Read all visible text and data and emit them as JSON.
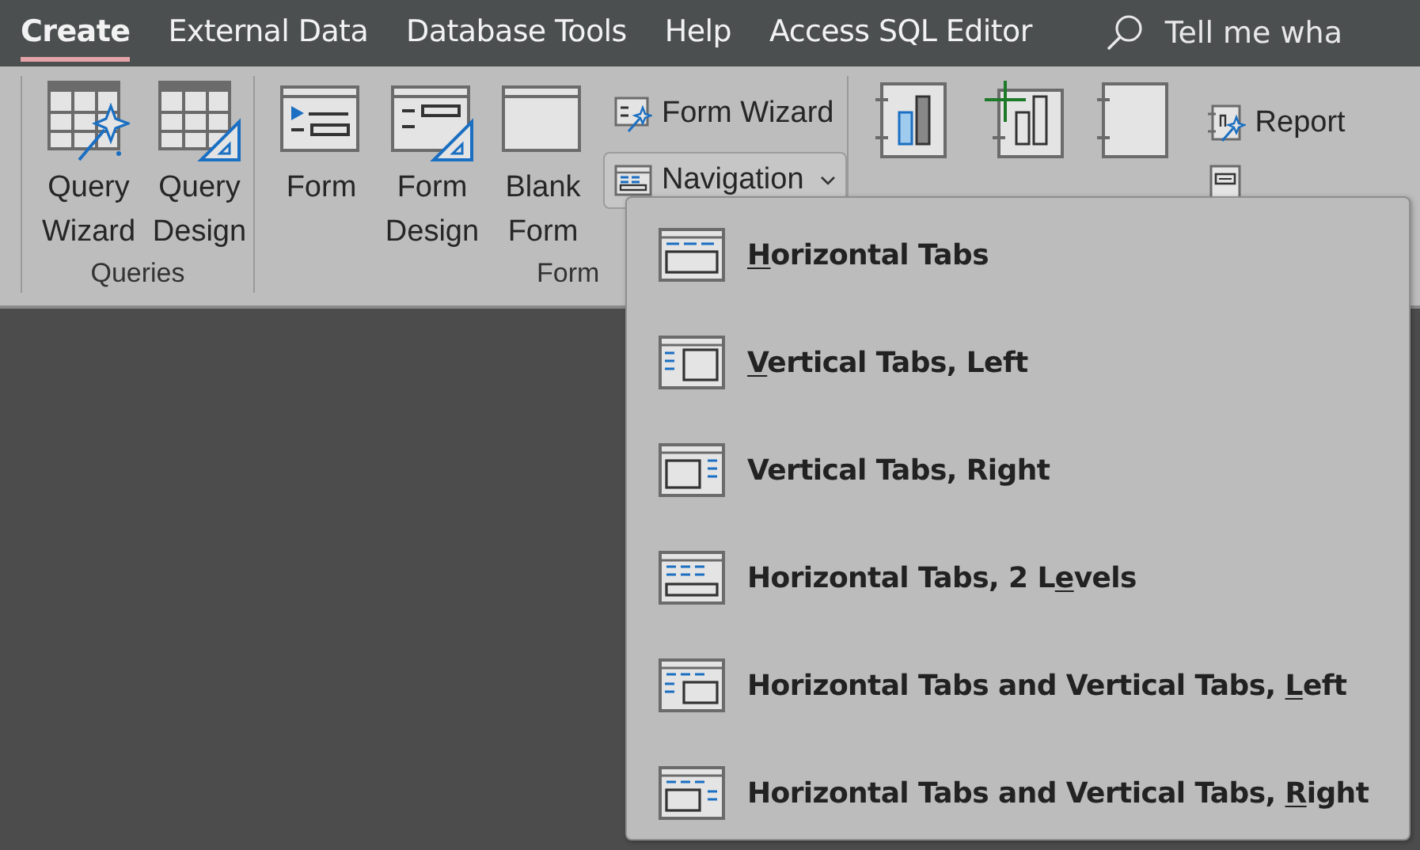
{
  "tabs": [
    {
      "label": "Create",
      "selected": true
    },
    {
      "label": "External Data",
      "selected": false
    },
    {
      "label": "Database Tools",
      "selected": false
    },
    {
      "label": "Help",
      "selected": false
    },
    {
      "label": "Access SQL Editor",
      "selected": false
    }
  ],
  "search": {
    "text": "Tell me wha"
  },
  "ribbon": {
    "groups": [
      {
        "label": "Queries",
        "buttons": [
          {
            "kind": "large",
            "label": "Query Wizard"
          },
          {
            "kind": "large",
            "label": "Query Design"
          }
        ]
      },
      {
        "label": "Form",
        "buttons": [
          {
            "kind": "large",
            "label": "Form"
          },
          {
            "kind": "large",
            "label": "Form Design"
          },
          {
            "kind": "large",
            "label": "Blank Form"
          },
          {
            "kind": "small",
            "label": "Form Wizard"
          },
          {
            "kind": "dropdown",
            "label": "Navigation",
            "expanded": true
          }
        ]
      },
      {
        "buttons": [
          {
            "kind": "large"
          },
          {
            "kind": "large"
          },
          {
            "kind": "large"
          },
          {
            "kind": "small",
            "label": "Report"
          },
          {
            "kind": "small"
          }
        ]
      }
    ]
  },
  "menu": {
    "items": [
      {
        "kind": "top",
        "key": "H",
        "after": "orizontal Tabs"
      },
      {
        "kind": "left",
        "key": "V",
        "after": "ertical Tabs, Left"
      },
      {
        "kind": "right",
        "before": "Vertical Tabs, Right"
      },
      {
        "kind": "top2",
        "before": "Horizontal Tabs, 2 L",
        "key": "e",
        "after": "vels"
      },
      {
        "kind": "topleft",
        "before": "Horizontal Tabs and Vertical Tabs, ",
        "key": "L",
        "after": "eft"
      },
      {
        "kind": "topright",
        "before": "Horizontal Tabs and Vertical Tabs, ",
        "key": "R",
        "after": "ight"
      }
    ]
  }
}
